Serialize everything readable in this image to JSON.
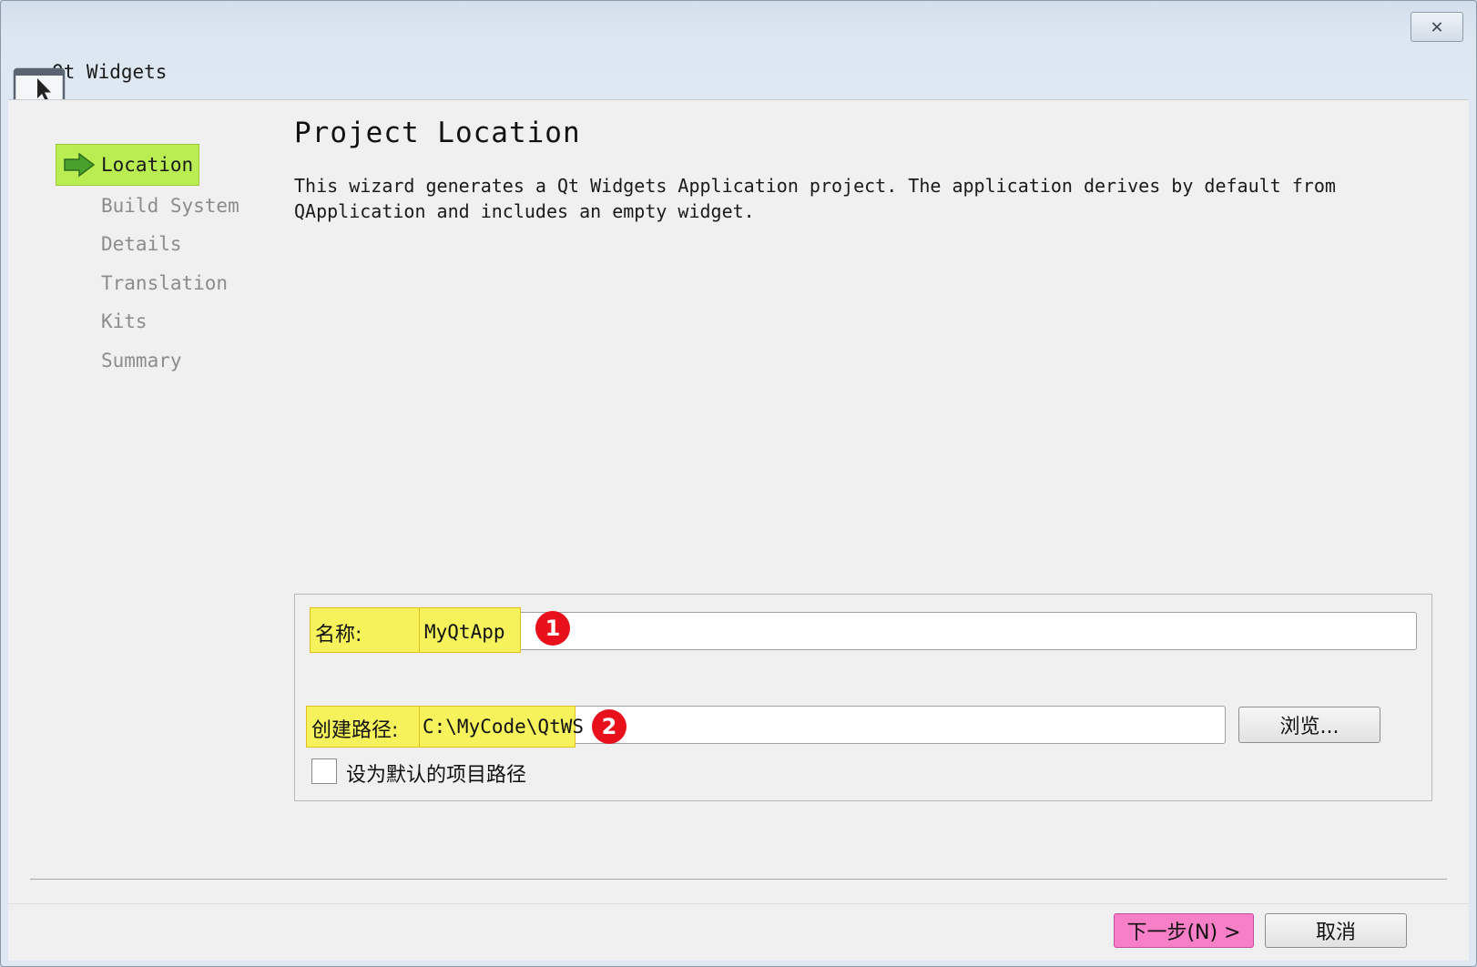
{
  "window": {
    "title": "Qt Widgets",
    "close_glyph": "✕"
  },
  "steps": [
    {
      "label": "Location",
      "active": true
    },
    {
      "label": "Build System",
      "active": false
    },
    {
      "label": "Details",
      "active": false
    },
    {
      "label": "Translation",
      "active": false
    },
    {
      "label": "Kits",
      "active": false
    },
    {
      "label": "Summary",
      "active": false
    }
  ],
  "page": {
    "title": "Project Location",
    "description": "This wizard generates a Qt Widgets Application project. The application derives by default from\nQApplication and includes an empty widget."
  },
  "form": {
    "name_label": "名称:",
    "name_value": "MyQtApp",
    "name_badge": "1",
    "path_label": "创建路径:",
    "path_value": "C:\\MyCode\\QtWS",
    "path_badge": "2",
    "browse_label": "浏览...",
    "default_path_label": "设为默认的项目路径",
    "default_path_checked": false
  },
  "footer": {
    "next_label": "下一步(N) >",
    "cancel_label": "取消"
  },
  "colors": {
    "active_step": "#b9ed52",
    "highlight": "#f5f25c",
    "badge": "#e8101a",
    "next_button": "#f77fc7"
  }
}
